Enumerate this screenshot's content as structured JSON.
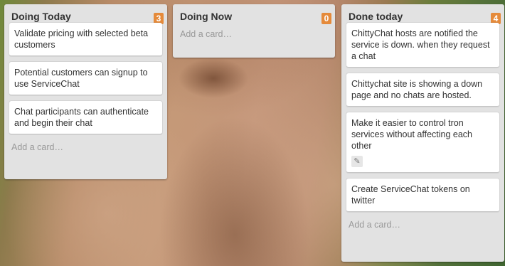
{
  "lists": [
    {
      "title": "Doing Today",
      "count": "3",
      "add_card": "Add a card…",
      "cards": [
        {
          "text": "Validate pricing with selected beta customers"
        },
        {
          "text": "Potential customers can signup to use ServiceChat"
        },
        {
          "text": "Chat participants can authenticate and begin their chat"
        }
      ]
    },
    {
      "title": "Doing Now",
      "count": "0",
      "add_card": "Add a card…",
      "cards": []
    },
    {
      "title": "Done today",
      "count": "4",
      "add_card": "Add a card…",
      "cards": [
        {
          "text": "ChittyChat hosts are notified the service is down. when they request a chat"
        },
        {
          "text": "Chittychat site is showing a down page and no chats are hosted."
        },
        {
          "text": "Make it easier to control tron services without affecting each other",
          "edit_icon": "pencil-icon"
        },
        {
          "text": "Create ServiceChat tokens on twitter"
        }
      ]
    }
  ]
}
